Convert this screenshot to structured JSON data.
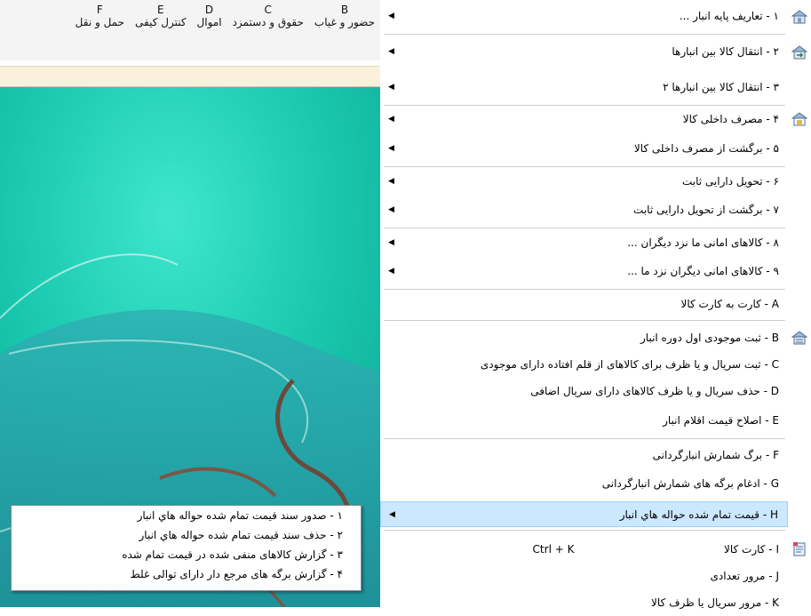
{
  "app": {
    "top_items": [
      {
        "letter": "B",
        "label": "حضور و غیاب"
      },
      {
        "letter": "C",
        "label": "حقوق و دستمزد"
      },
      {
        "letter": "D",
        "label": "اموال"
      },
      {
        "letter": "E",
        "label": "کنترل کیفی"
      },
      {
        "letter": "F",
        "label": "حمل و نقل"
      }
    ]
  },
  "menu": {
    "items": [
      {
        "label": "۱ - تعاریف پایه انبار ...",
        "has_submenu": true,
        "icon": "warehouse-icon"
      },
      {
        "label": "۲ - انتقال کالا بین انبارها",
        "has_submenu": true,
        "icon": "warehouse-transfer-icon"
      },
      {
        "label": "۳ - انتقال کالا بین انبارها ۲",
        "has_submenu": true
      },
      {
        "label": "۴ - مصرف داخلی کالا",
        "has_submenu": true,
        "icon": "warehouse-consume-icon"
      },
      {
        "label": "۵ - برگشت از مصرف داخلی کالا",
        "has_submenu": true
      },
      {
        "label": "۶ - تحویل دارایی ثابت",
        "has_submenu": true
      },
      {
        "label": "۷ - برگشت از تحویل دارایی ثابت",
        "has_submenu": true
      },
      {
        "label": "۸ - کالاهای امانی ما نزد دیگران ...",
        "has_submenu": true
      },
      {
        "label": "۹ - کالاهای امانی دیگران نزد ما ...",
        "has_submenu": true
      },
      {
        "label": "A - کارت به کارت کالا",
        "has_submenu": false
      },
      {
        "label": "B - ثبت موجودی اول دوره انبار",
        "has_submenu": false,
        "icon": "warehouse-inventory-icon"
      },
      {
        "label": "C - ثبت سریال و یا ظرف برای کالاهای از قلم افتاده دارای موجودی",
        "has_submenu": false
      },
      {
        "label": "D - حذف سریال و یا ظرف کالاهای دارای سریال اضافی",
        "has_submenu": false
      },
      {
        "label": "E - اصلاح قیمت اقلام انبار",
        "has_submenu": false
      },
      {
        "label": "F - برگ شمارش انبارگردانی",
        "has_submenu": false
      },
      {
        "label": "G - ادغام برگه های شمارش انبارگردانی",
        "has_submenu": false
      },
      {
        "label": "H - قیمت تمام شده حواله هاي انبار",
        "has_submenu": true,
        "highlighted": true
      },
      {
        "label": "I - کارت کالا",
        "shortcut": "Ctrl + K",
        "has_submenu": false,
        "icon": "stock-card-icon"
      },
      {
        "label": "J - مرور تعدادی",
        "has_submenu": false
      },
      {
        "label": "K - مرور سریال یا ظرف کالا",
        "has_submenu": false
      }
    ]
  },
  "submenu": {
    "items": [
      "۱ - صدور سند قیمت تمام شده حواله هاي انبار",
      "۲ - حذف سند قیمت تمام شده حواله هاي انبار",
      "۳ - گزارش کالاهای منفی شده در قیمت تمام شده",
      "۴ - گزارش برگه های مرجع دار دارای توالی غلط"
    ]
  },
  "colors": {
    "teal_background": "#1bc9b0",
    "highlight": "#cce8ff",
    "highlight_border": "#99d1ff",
    "toolbar_strip": "#faf1dc"
  }
}
